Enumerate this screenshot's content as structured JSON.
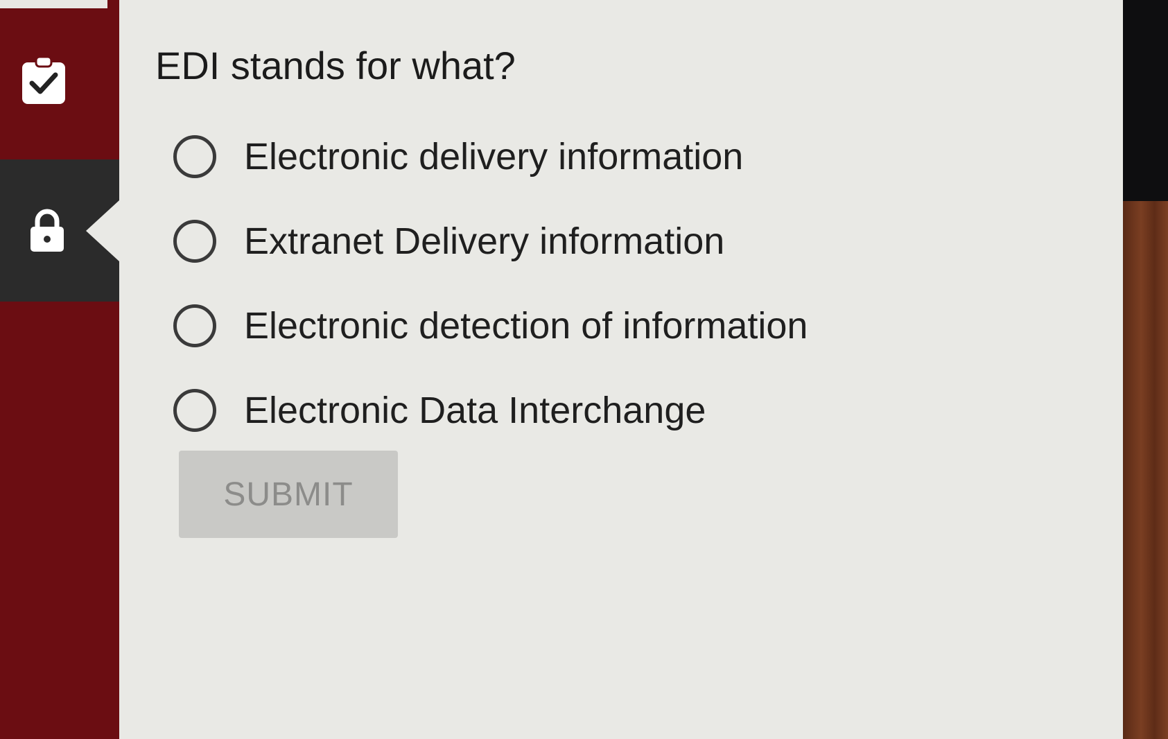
{
  "sidebar": {
    "items": [
      {
        "icon": "clipboard-check-icon",
        "active": false
      },
      {
        "icon": "lock-icon",
        "active": true
      }
    ]
  },
  "quiz": {
    "question": "EDI stands for what?",
    "options": [
      {
        "label": "Electronic delivery information",
        "selected": false
      },
      {
        "label": "Extranet Delivery information",
        "selected": false
      },
      {
        "label": "Electronic detection of information",
        "selected": false
      },
      {
        "label": "Electronic Data Interchange",
        "selected": false
      }
    ],
    "submit_label": "SUBMIT",
    "submit_enabled": false
  },
  "colors": {
    "sidebar": "#6b0d12",
    "sidebar_active": "#2b2b2b",
    "panel": "#e9e9e5",
    "submit_disabled": "#c9c9c6"
  }
}
